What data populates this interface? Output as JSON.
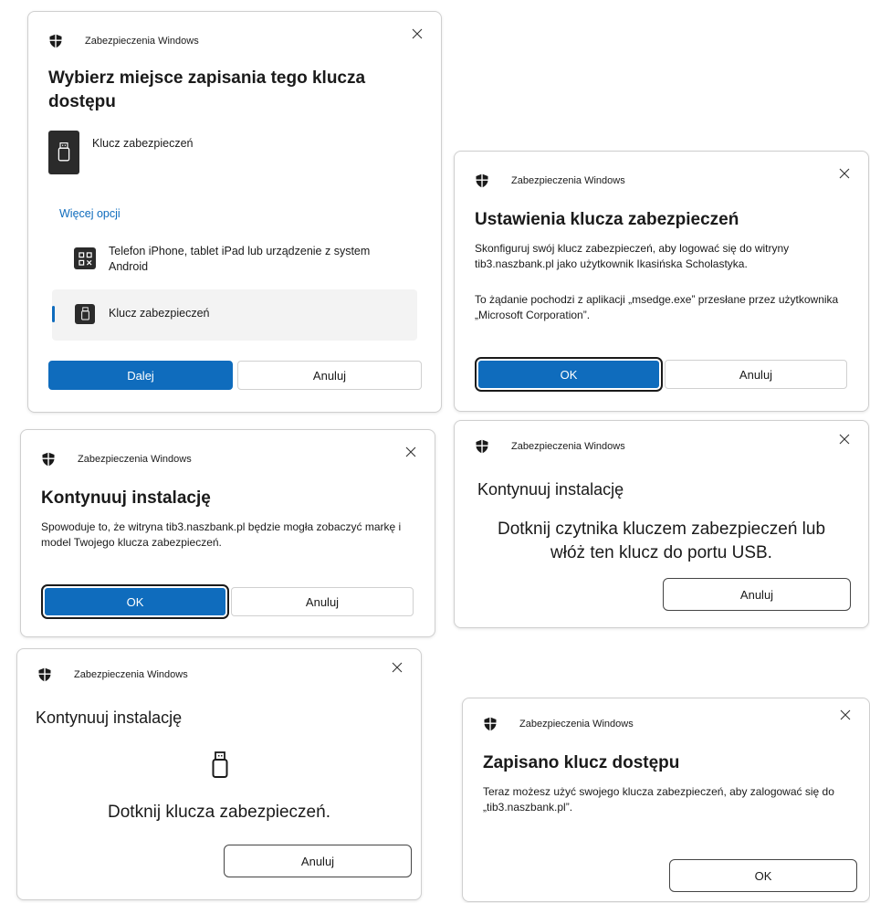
{
  "app_name": "Zabezpieczenia Windows",
  "dialog1": {
    "title": "Wybierz miejsce zapisania tego klucza dostępu",
    "primary_option": "Klucz zabezpieczeń",
    "more_options_link": "Więcej opcji",
    "options": [
      {
        "label": "Telefon iPhone, tablet iPad lub urządzenie z system Android",
        "icon": "qr-code-icon"
      },
      {
        "label": "Klucz zabezpieczeń",
        "icon": "usb-key-icon"
      }
    ],
    "next_label": "Dalej",
    "cancel_label": "Anuluj"
  },
  "dialog2": {
    "title": "Ustawienia klucza zabezpieczeń",
    "body1": "Skonfiguruj swój klucz zabezpieczeń, aby logować się do witryny tib3.naszbank.pl jako użytkownik Ikasińska Scholastyka.",
    "body2": "To żądanie pochodzi z aplikacji „msedge.exe” przesłane przez użytkownika „Microsoft Corporation”.",
    "ok_label": "OK",
    "cancel_label": "Anuluj"
  },
  "dialog3": {
    "title": "Kontynuuj instalację",
    "body": "Spowoduje to, że witryna tib3.naszbank.pl będzie mogła zobaczyć markę i model Twojego klucza zabezpieczeń.",
    "ok_label": "OK",
    "cancel_label": "Anuluj"
  },
  "dialog4": {
    "title": "Kontynuuj instalację",
    "body": "Dotknij czytnika kluczem zabezpieczeń lub włóż ten klucz do portu USB.",
    "cancel_label": "Anuluj"
  },
  "dialog5": {
    "title": "Kontynuuj instalację",
    "body": "Dotknij klucza zabezpieczeń.",
    "cancel_label": "Anuluj"
  },
  "dialog6": {
    "title": "Zapisano klucz dostępu",
    "body": "Teraz możesz użyć swojego klucza zabezpieczeń, aby zalogować się do „tib3.naszbank.pl”.",
    "ok_label": "OK"
  },
  "colors": {
    "accent": "#0f6cbd",
    "text": "#1a1a1a",
    "border": "#d0d0d0"
  }
}
